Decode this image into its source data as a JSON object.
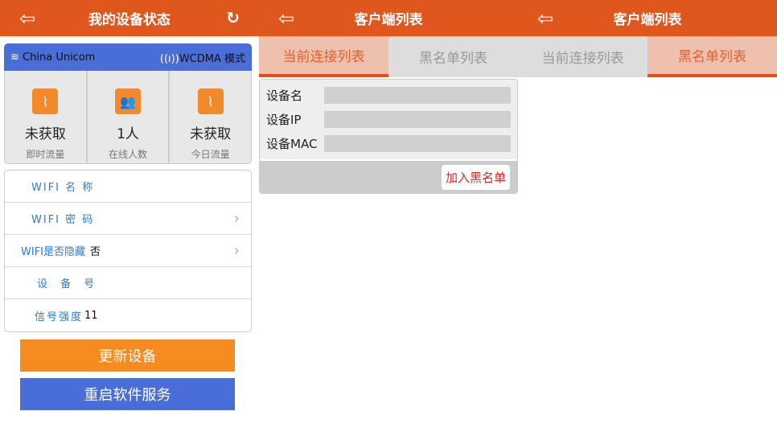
{
  "panel1": {
    "title": "我的设备状态",
    "carrier": "China Unicom",
    "mode": "WCDMA 模式",
    "stats": [
      {
        "value": "未获取",
        "label": "即时流量"
      },
      {
        "value": "1人",
        "label": "在线人数"
      },
      {
        "value": "未获取",
        "label": "今日流量"
      }
    ],
    "rows": [
      {
        "label": "WIFI 名 称",
        "value": ""
      },
      {
        "label": "WIFI 密 码",
        "value": ""
      },
      {
        "label": "WIFI是否隐藏",
        "value": "否"
      },
      {
        "label": "设 备 号",
        "value": ""
      },
      {
        "label": "信号强度",
        "value": "11"
      }
    ],
    "update_button": "更新设备",
    "restart_button": "重启软件服务"
  },
  "panel2": {
    "title": "客户端列表",
    "tabs": [
      "当前连接列表",
      "黑名单列表"
    ],
    "fields": [
      "设备名",
      "设备IP",
      "设备MAC"
    ],
    "blacklist_button": "加入黑名单"
  },
  "panel3": {
    "title": "客户端列表",
    "tabs": [
      "当前连接列表",
      "黑名单列表"
    ]
  },
  "colors": {
    "header": "#E0571E",
    "orange": "#F68B1F",
    "blue": "#4A6ED8"
  }
}
